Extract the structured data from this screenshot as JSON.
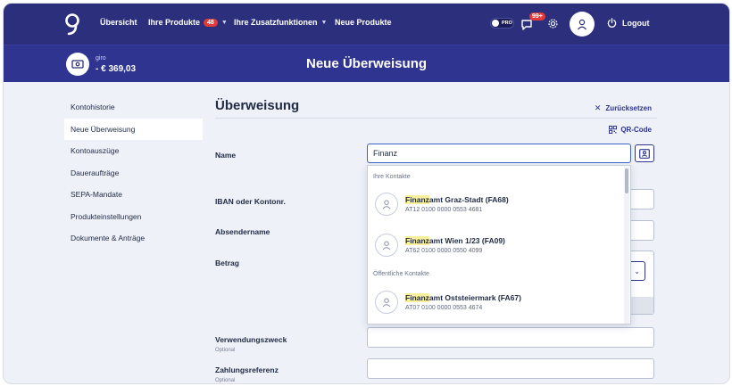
{
  "nav": {
    "overview": "Übersicht",
    "products": "Ihre Produkte",
    "products_badge": "48",
    "extras": "Ihre Zusatzfunktionen",
    "new_products": "Neue Produkte",
    "pro_label": "PRO",
    "messages_badge": "99+",
    "logout": "Logout"
  },
  "account": {
    "name": "giro",
    "balance": "- € 369,03",
    "page_title": "Neue Überweisung"
  },
  "sidebar": {
    "items": [
      {
        "label": "Kontohistorie",
        "active": false
      },
      {
        "label": "Neue Überweisung",
        "active": true
      },
      {
        "label": "Kontoauszüge",
        "active": false
      },
      {
        "label": "Daueraufträge",
        "active": false
      },
      {
        "label": "SEPA-Mandate",
        "active": false
      },
      {
        "label": "Produkteinstellungen",
        "active": false
      },
      {
        "label": "Dokumente & Anträge",
        "active": false
      }
    ]
  },
  "form": {
    "heading": "Überweisung",
    "reset": "Zurücksetzen",
    "qr": "QR-Code",
    "name_label": "Name",
    "name_value": "Finanz",
    "iban_label": "IBAN oder Kontonr.",
    "sender_label": "Absendername",
    "amount_label": "Betrag",
    "purpose_label": "Verwendungszweck",
    "purpose_optional": "Optional",
    "reference_label": "Zahlungsreferenz",
    "reference_optional": "Optional"
  },
  "suggestions": {
    "own_contacts_title": "Ihre Kontakte",
    "public_contacts_title": "Öffentliche Kontakte",
    "highlight": "Finanz",
    "items": [
      {
        "rest": "amt Graz-Stadt (FA68)",
        "iban": "AT12 0100 0000 0553 4681"
      },
      {
        "rest": "amt Wien 1/23 (FA09)",
        "iban": "AT62 0100 0000 0550 4099"
      },
      {
        "rest": "amt Oststeiermark (FA67)",
        "iban": "AT07 0100 0000 0553 4674"
      }
    ]
  },
  "colors": {
    "nav_bg": "#2b2f7c",
    "subheader_bg": "#2e3490",
    "badge_red": "#e03a3a",
    "highlight": "#f8ef9a",
    "page_bg": "#eef1f7"
  }
}
